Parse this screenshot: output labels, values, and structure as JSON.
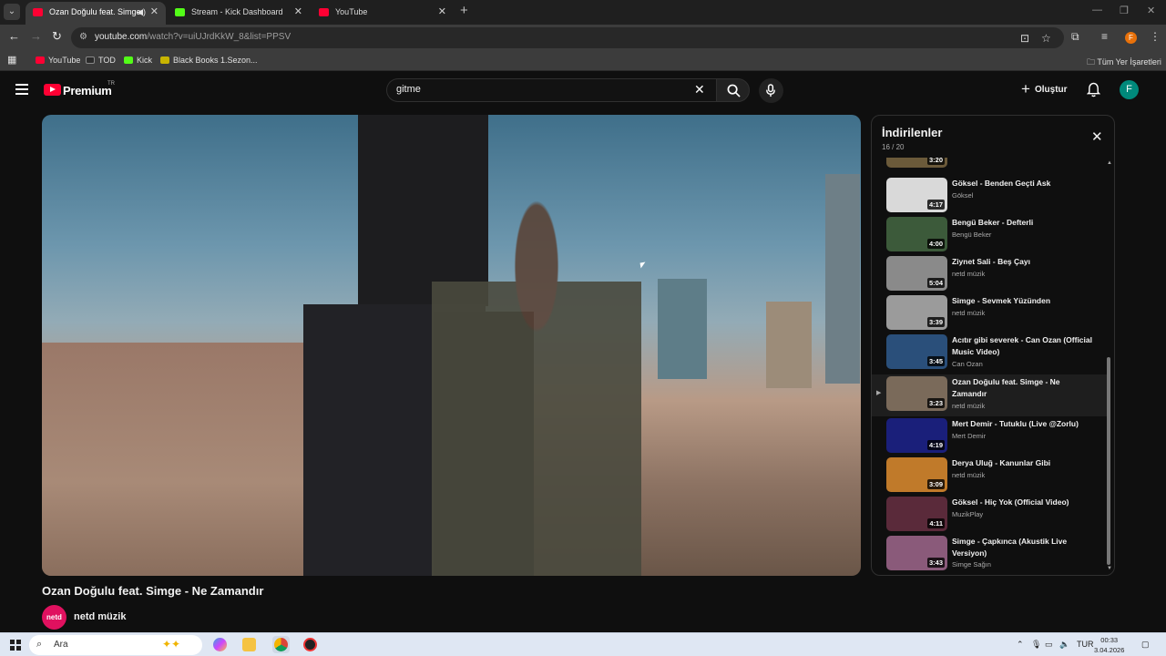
{
  "browser": {
    "tabs": [
      {
        "title": "Ozan Doğulu feat. Simge - Ne Zamandır",
        "active": true,
        "favicon_color": "#ff0033"
      },
      {
        "title": "Stream - Kick Dashboard",
        "active": false,
        "favicon_color": "#53fc18"
      },
      {
        "title": "YouTube",
        "active": false,
        "favicon_color": "#ff0033"
      }
    ],
    "new_tab_icon": "+",
    "url_host": "youtube.com",
    "url_path": "/watch?v=uiUJrdKkW_8&list=PPSV",
    "profile_initial": "F",
    "bookmarks": [
      {
        "label": "YouTube",
        "icon_color": "#ff0033"
      },
      {
        "label": "TOD",
        "icon_color": "#2b2b2b"
      },
      {
        "label": "Kick",
        "icon_color": "#53fc18"
      },
      {
        "label": "Black Books 1.Sezon...",
        "icon_color": "#c8b400"
      }
    ],
    "all_bookmarks": "Tüm Yer İşaretleri"
  },
  "youtube": {
    "brand": "Premium",
    "region": "TR",
    "search_value": "gitme",
    "create_label": "Oluştur",
    "avatar_initial": "F",
    "video_title": "Ozan Doğulu feat. Simge - Ne Zamandır",
    "channel_name": "netd müzik",
    "channel_avatar_text": "netd"
  },
  "playlist": {
    "title": "İndirilenler",
    "count": "16 / 20",
    "items": [
      {
        "title": "",
        "channel": "",
        "duration": "3:20",
        "thumb": "#6b5a3a"
      },
      {
        "title": "Göksel - Benden Geçti Ask",
        "channel": "Göksel",
        "duration": "4:17",
        "thumb": "#d9d9d9"
      },
      {
        "title": "Bengü Beker - Defterli",
        "channel": "Bengü Beker",
        "duration": "4:00",
        "thumb": "#3c5a3a"
      },
      {
        "title": "Ziynet Sali - Beş Çayı",
        "channel": "netd müzik",
        "duration": "5:04",
        "thumb": "#8a8a8a"
      },
      {
        "title": "Simge - Sevmek Yüzünden",
        "channel": "netd müzik",
        "duration": "3:39",
        "thumb": "#9b9b9b"
      },
      {
        "title": "Acıtır gibi severek - Can Ozan (Official Music Video)",
        "channel": "Can Ozan",
        "duration": "3:45",
        "thumb": "#2a4f7a"
      },
      {
        "title": "Ozan Doğulu feat. Simge - Ne Zamandır",
        "channel": "netd müzik",
        "duration": "3:23",
        "thumb": "#7a6a5a"
      },
      {
        "title": "Mert Demir - Tutuklu (Live @Zorlu)",
        "channel": "Mert Demir",
        "duration": "4:19",
        "thumb": "#1a1f7a"
      },
      {
        "title": "Derya Uluğ - Kanunlar Gibi",
        "channel": "netd müzik",
        "duration": "3:09",
        "thumb": "#c07a2a"
      },
      {
        "title": "Göksel - Hiç Yok (Official Video)",
        "channel": "MuzikPlay",
        "duration": "4:11",
        "thumb": "#5a2a3a"
      },
      {
        "title": "Simge - Çapkınca (Akustik Live Versiyon)",
        "channel": "Simge Sağın",
        "duration": "3:43",
        "thumb": "#8a5a7a"
      }
    ]
  },
  "taskbar": {
    "search_label": "Ara",
    "language": "TUR",
    "time": "00:33",
    "date": "3.04.2026"
  }
}
